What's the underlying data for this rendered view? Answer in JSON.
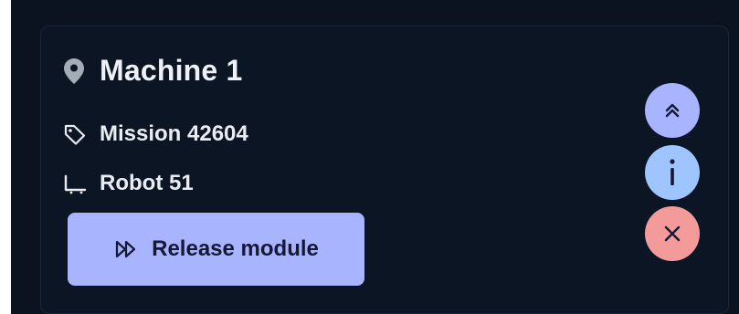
{
  "card": {
    "title": "Machine 1",
    "title_icon": "location-pin-icon",
    "mission": {
      "label": "Mission 42604",
      "icon": "tag-icon"
    },
    "robot": {
      "label": "Robot 51",
      "icon": "robot-cart-icon"
    },
    "release_button": {
      "label": "Release module",
      "icon": "fast-forward-icon"
    }
  },
  "actions": {
    "collapse": {
      "icon": "chevron-double-up-icon",
      "color": "#a9b4ff"
    },
    "info": {
      "icon": "info-icon",
      "color": "#9ec5ff"
    },
    "close": {
      "icon": "close-icon",
      "color": "#f39b9b"
    }
  },
  "colors": {
    "background": "#0b1320",
    "card_background": "#0c1524",
    "text": "#eef2f8",
    "accent": "#a9b4ff"
  }
}
